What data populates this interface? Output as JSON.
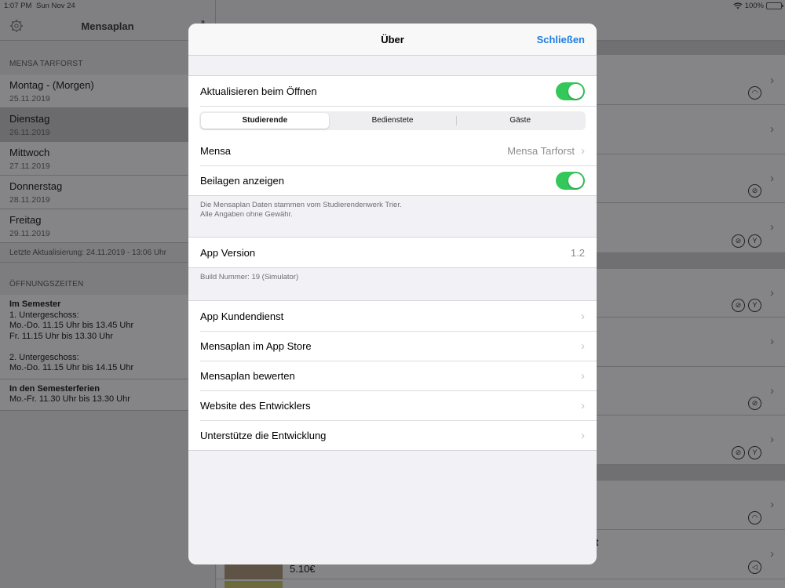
{
  "status": {
    "time": "1:07 PM",
    "date": "Sun Nov 24",
    "battery": "100%"
  },
  "left": {
    "title": "Mensaplan",
    "section_mensa": "MENSA TARFORST",
    "days": [
      {
        "name": "Montag - (Morgen)",
        "date": "25.11.2019"
      },
      {
        "name": "Dienstag",
        "date": "26.11.2019"
      },
      {
        "name": "Mittwoch",
        "date": "27.11.2019"
      },
      {
        "name": "Donnerstag",
        "date": "28.11.2019"
      },
      {
        "name": "Freitag",
        "date": "29.11.2019"
      }
    ],
    "selected_day": 1,
    "last_update": "Letzte Aktualisierung: 24.11.2019 - 13:06 Uhr",
    "section_hours": "ÖFFNUNGSZEITEN",
    "hours": {
      "semester_title": "Im Semester",
      "semester_lines": [
        "1. Untergeschoss:",
        "Mo.-Do. 11.15 Uhr bis 13.45 Uhr",
        "Fr. 11.15 Uhr bis 13.30 Uhr",
        "",
        "2. Untergeschoss:",
        "Mo.-Do. 11.15 Uhr bis 14.15 Uhr"
      ],
      "holidays_title": "In den Semesterferien",
      "holidays_lines": [
        "Mo.-Fr. 11.30 Uhr bis 13.30 Uhr"
      ]
    }
  },
  "background": {
    "partial_title": "Di...",
    "price": "5.10€",
    "partial_text": "t"
  },
  "modal": {
    "title": "Über",
    "close_label": "Schließen",
    "refresh_on_open": {
      "label": "Aktualisieren beim Öffnen",
      "on": true
    },
    "segments": [
      "Studierende",
      "Bedienstete",
      "Gäste"
    ],
    "segment_selected": 0,
    "mensa": {
      "label": "Mensa",
      "value": "Mensa Tarforst"
    },
    "show_sides": {
      "label": "Beilagen anzeigen",
      "on": true
    },
    "data_note_1": "Die Mensaplan Daten stammen vom Studierendenwerk Trier.",
    "data_note_2": "Alle Angaben ohne Gewähr.",
    "app_version": {
      "label": "App Version",
      "value": "1.2"
    },
    "build_note": "Build Nummer: 19 (Simulator)",
    "links": [
      "App Kundendienst",
      "Mensaplan im App Store",
      "Mensaplan bewerten",
      "Website des Entwicklers",
      "Unterstütze die Entwicklung"
    ]
  },
  "colors": {
    "accent": "#1f7fe0",
    "toggle_on": "#34c759"
  }
}
